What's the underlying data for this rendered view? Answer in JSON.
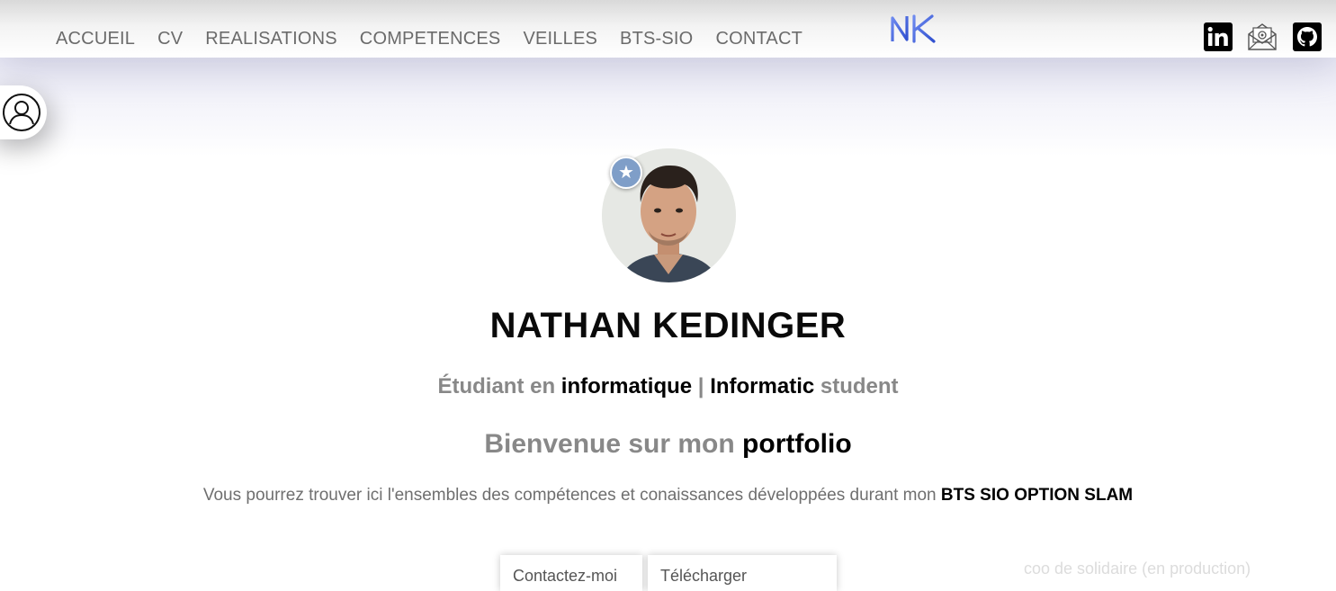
{
  "nav": {
    "items": [
      "ACCUEIL",
      "CV",
      "REALISATIONS",
      "COMPETENCES",
      "VEILLES",
      "BTS-SIO",
      "CONTACT"
    ]
  },
  "logo": {
    "text": "NK",
    "color": "#4a63d6"
  },
  "social": {
    "linkedin_icon": "linkedin-icon",
    "mail_icon": "mail-icon",
    "github_icon": "github-icon"
  },
  "hero": {
    "name": "NATHAN KEDINGER",
    "subtitle": {
      "part1": "Étudiant en ",
      "part2": "informatique",
      "part3": " | ",
      "part4": "Informatic",
      "part5": " student"
    },
    "welcome": {
      "part1": "Bienvenue sur mon ",
      "part2": "portfolio"
    },
    "intro": {
      "text": "Vous pourrez trouver ici l'ensembles des compétences et conaissances développées durant mon ",
      "highlight": "BTS SIO OPTION SLAM"
    }
  },
  "buttons": {
    "contact": "Contactez-moi",
    "download": "Télécharger"
  },
  "faded_text": "coo de solidaire (en production)",
  "colors": {
    "text_gray": "#888888",
    "badge": "#7f9ec8"
  }
}
